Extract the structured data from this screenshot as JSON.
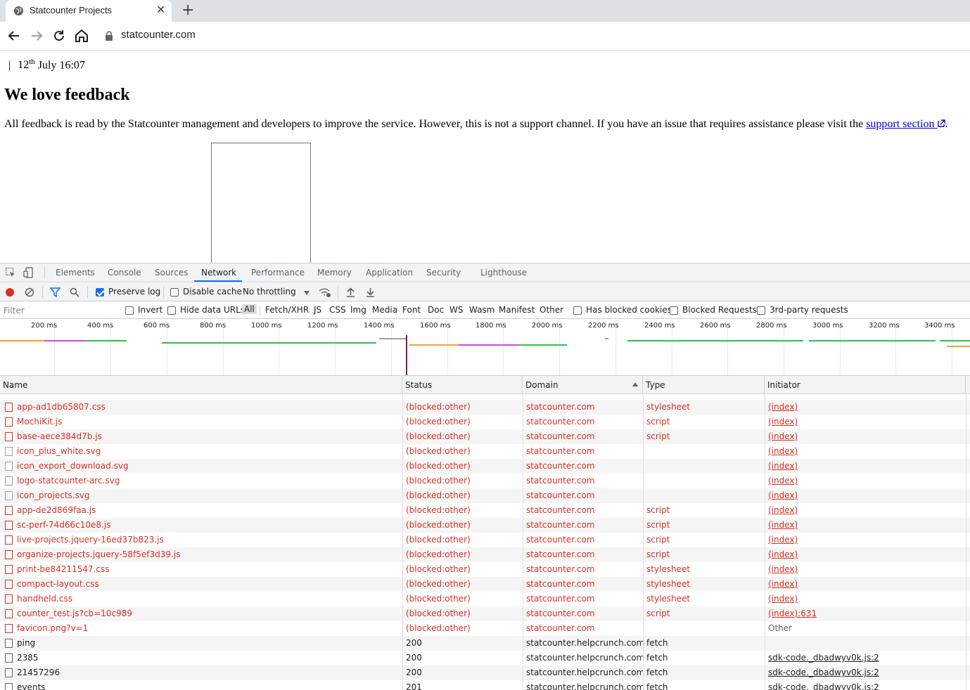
{
  "browser": {
    "tab_title": "Statcounter Projects",
    "new_tab": "+",
    "close": "✕",
    "url": "statcounter.com"
  },
  "page": {
    "date_sep": "|",
    "date_day": "12",
    "date_sup": "th",
    "date_rest": " July 16:07",
    "heading": "We love feedback",
    "para_text": "All feedback is read by the Statcounter management and developers to improve the service. However, this is not a support channel. If you have an issue that requires assistance please visit the ",
    "support_link": "support section",
    "para_end": "."
  },
  "devtools": {
    "tabs": [
      "Elements",
      "Console",
      "Sources",
      "Network",
      "Performance",
      "Memory",
      "Application",
      "Security",
      "Lighthouse"
    ],
    "active_tab": "Network",
    "toolbar": {
      "preserve_log": "Preserve log",
      "disable_cache": "Disable cache",
      "throttling": "No throttling"
    },
    "filter": {
      "placeholder": "Filter",
      "invert": "Invert",
      "hide_data_urls": "Hide data URLs",
      "types": [
        "All",
        "Fetch/XHR",
        "JS",
        "CSS",
        "Img",
        "Media",
        "Font",
        "Doc",
        "WS",
        "Wasm",
        "Manifest",
        "Other"
      ],
      "has_blocked_cookies": "Has blocked cookies",
      "blocked_requests": "Blocked Requests",
      "third_party": "3rd-party requests"
    },
    "overview": {
      "ticks": [
        "200 ms",
        "400 ms",
        "600 ms",
        "800 ms",
        "1000 ms",
        "1200 ms",
        "1400 ms",
        "1600 ms",
        "1800 ms",
        "2000 ms",
        "2200 ms",
        "2400 ms",
        "2600 ms",
        "2800 ms",
        "3000 ms",
        "3200 ms",
        "3400 ms"
      ]
    },
    "table": {
      "columns": [
        "Name",
        "Status",
        "Domain",
        "Type",
        "Initiator"
      ],
      "rows": [
        {
          "name": "app-ad1db65807.css",
          "status": "(blocked:other)",
          "domain": "statcounter.com",
          "type": "stylesheet",
          "initiator": "(index)"
        },
        {
          "name": "MochiKit.js",
          "status": "(blocked:other)",
          "domain": "statcounter.com",
          "type": "script",
          "initiator": "(index)"
        },
        {
          "name": "base-aece384d7b.js",
          "status": "(blocked:other)",
          "domain": "statcounter.com",
          "type": "script",
          "initiator": "(index)"
        },
        {
          "name": "icon_plus_white.svg",
          "status": "(blocked:other)",
          "domain": "statcounter.com",
          "type": "",
          "initiator": "(index)"
        },
        {
          "name": "icon_export_download.svg",
          "status": "(blocked:other)",
          "domain": "statcounter.com",
          "type": "",
          "initiator": "(index)"
        },
        {
          "name": "logo-statcounter-arc.svg",
          "status": "(blocked:other)",
          "domain": "statcounter.com",
          "type": "",
          "initiator": "(index)"
        },
        {
          "name": "icon_projects.svg",
          "status": "(blocked:other)",
          "domain": "statcounter.com",
          "type": "",
          "initiator": "(index)"
        },
        {
          "name": "app-de2d869faa.js",
          "status": "(blocked:other)",
          "domain": "statcounter.com",
          "type": "script",
          "initiator": "(index)"
        },
        {
          "name": "sc-perf-74d66c10e8.js",
          "status": "(blocked:other)",
          "domain": "statcounter.com",
          "type": "script",
          "initiator": "(index)"
        },
        {
          "name": "live-projects.jquery-16ed37b823.js",
          "status": "(blocked:other)",
          "domain": "statcounter.com",
          "type": "script",
          "initiator": "(index)"
        },
        {
          "name": "organize-projects.jquery-58f5ef3d39.js",
          "status": "(blocked:other)",
          "domain": "statcounter.com",
          "type": "script",
          "initiator": "(index)"
        },
        {
          "name": "print-be84211547.css",
          "status": "(blocked:other)",
          "domain": "statcounter.com",
          "type": "stylesheet",
          "initiator": "(index)"
        },
        {
          "name": "compact-layout.css",
          "status": "(blocked:other)",
          "domain": "statcounter.com",
          "type": "stylesheet",
          "initiator": "(index)"
        },
        {
          "name": "handheld.css",
          "status": "(blocked:other)",
          "domain": "statcounter.com",
          "type": "stylesheet",
          "initiator": "(index)"
        },
        {
          "name": "counter_test.js?cb=10c989",
          "status": "(blocked:other)",
          "domain": "statcounter.com",
          "type": "script",
          "initiator": "(index):631"
        },
        {
          "name": "favicon.png?v=1",
          "status": "(blocked:other)",
          "domain": "statcounter.com",
          "type": "",
          "initiator": "Other"
        },
        {
          "name": "ping",
          "status": "200",
          "domain": "statcounter.helpcrunch.com",
          "type": "fetch",
          "initiator": ""
        },
        {
          "name": "2385",
          "status": "200",
          "domain": "statcounter.helpcrunch.com",
          "type": "fetch",
          "initiator": "sdk-code._dbadwyv0k.js:2"
        },
        {
          "name": "21457296",
          "status": "200",
          "domain": "statcounter.helpcrunch.com",
          "type": "fetch",
          "initiator": "sdk-code._dbadwyv0k.js:2"
        },
        {
          "name": "events",
          "status": "201",
          "domain": "statcounter.helpcrunch.com",
          "type": "fetch",
          "initiator": "sdk-code._dbadwyv0k.js:2"
        }
      ]
    }
  }
}
